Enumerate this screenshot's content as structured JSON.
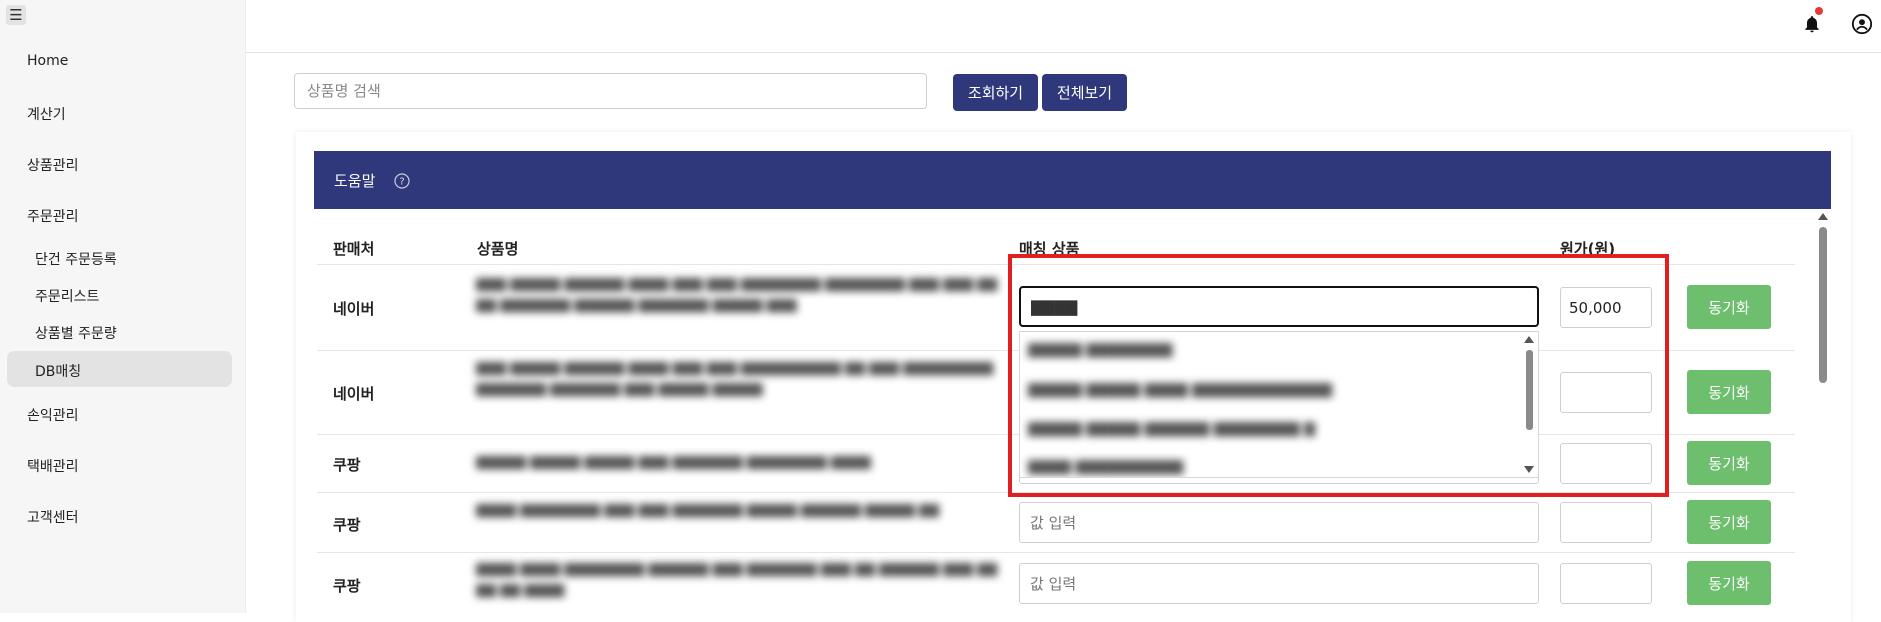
{
  "sidebar": {
    "menu_icon": "☰",
    "items": [
      {
        "label": "Home"
      },
      {
        "label": "계산기"
      },
      {
        "label": "상품관리"
      },
      {
        "label": "주문관리"
      },
      {
        "label": "단건 주문등록"
      },
      {
        "label": "주문리스트"
      },
      {
        "label": "상품별 주문량"
      },
      {
        "label": "DB매칭"
      },
      {
        "label": "손익관리"
      },
      {
        "label": "택배관리"
      },
      {
        "label": "고객센터"
      }
    ]
  },
  "topbar": {
    "icons": [
      "bell-icon",
      "account-circle-icon"
    ],
    "notification_dot_color": "#e53935"
  },
  "search": {
    "placeholder": "상품명 검색",
    "search_button": "조회하기",
    "view_all_button": "전체보기"
  },
  "help": {
    "title": "도움말",
    "icon": "?"
  },
  "table": {
    "headers": {
      "seller": "판매처",
      "product": "상품명",
      "matched": "매칭 상품",
      "cost": "원가(원)"
    },
    "rows": [
      {
        "seller": "네이버",
        "match_value": "▇▇▇▇",
        "match_placeholder": "",
        "cost": "50,000",
        "sync": "동기화"
      },
      {
        "seller": "네이버",
        "match_value": "",
        "match_placeholder": "",
        "cost": "",
        "sync": "동기화"
      },
      {
        "seller": "쿠팡",
        "match_value": "",
        "match_placeholder": "",
        "cost": "",
        "sync": "동기화"
      },
      {
        "seller": "쿠팡",
        "match_value": "",
        "match_placeholder": "값 입력",
        "cost": "",
        "sync": "동기화"
      },
      {
        "seller": "쿠팡",
        "match_value": "",
        "match_placeholder": "값 입력",
        "cost": "",
        "sync": "동기화"
      }
    ]
  },
  "colors": {
    "navy": "#2e387a",
    "sync_green": "#6dbf6e",
    "highlight_red": "#e02020"
  }
}
